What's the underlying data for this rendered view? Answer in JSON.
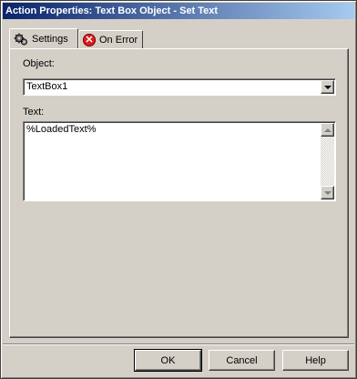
{
  "window": {
    "title": "Action Properties: Text Box Object - Set Text"
  },
  "tabs": [
    {
      "label": "Settings",
      "icon": "gears-icon",
      "active": true
    },
    {
      "label": "On Error",
      "icon": "error-x-icon",
      "active": false
    }
  ],
  "object_field": {
    "label": "Object:",
    "value": "TextBox1"
  },
  "text_field": {
    "label": "Text:",
    "value": "%LoadedText%"
  },
  "buttons": {
    "ok": "OK",
    "cancel": "Cancel",
    "help": "Help"
  },
  "icons": {
    "error": "✕"
  },
  "colors": {
    "titlebar_start": "#0a246a",
    "titlebar_end": "#a6caf0",
    "face": "#d4d0c8",
    "error_red": "#d81e1e"
  }
}
